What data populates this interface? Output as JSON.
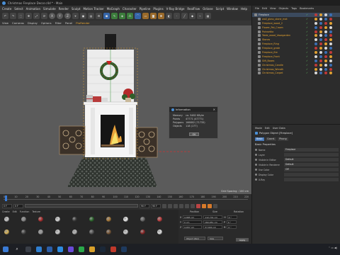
{
  "window": {
    "title": "Christmas Fireplace Decor.c4d * - Main"
  },
  "menubar": [
    "Create",
    "Select",
    "Animation",
    "Simulate",
    "Render",
    "Sculpt",
    "Motion Tracker",
    "MoGraph",
    "Character",
    "Pipeline",
    "Plugins",
    "V-Ray Bridge",
    "RealFlow",
    "Octane",
    "Script",
    "Window",
    "Help"
  ],
  "viewport_menu": {
    "items": [
      "View",
      "Cameras",
      "Display",
      "Options",
      "Filter",
      "Panel"
    ],
    "active": "ProRender"
  },
  "viewport": {
    "grid_spacing": "Grid Spacing : 100 cm"
  },
  "info_dialog": {
    "title": "Information",
    "rows": [
      {
        "label": "Memory",
        "value": "ca. 5482 KByte"
      },
      {
        "label": "Points",
        "value": "47771 (47771)"
      },
      {
        "label": "Polygons",
        "value": "166802 (71735)"
      },
      {
        "label": "Objects",
        "value": "118 (177)"
      }
    ],
    "ok_label": "OK"
  },
  "timeline": {
    "ticks": [
      "0",
      "10",
      "20",
      "30",
      "40",
      "50",
      "60",
      "70",
      "80",
      "90",
      "100",
      "110",
      "120",
      "130",
      "140",
      "150",
      "160",
      "170",
      "180",
      "190",
      "200",
      "210",
      "220"
    ],
    "current_frame": "0 F",
    "start_frame": "0 F",
    "end_frame": "90 F",
    "max_frame": "90 F"
  },
  "materials": {
    "menu": [
      "Create",
      "Edit",
      "Function",
      "Texture"
    ],
    "balls": [
      {
        "color": "#c9c9c9"
      },
      {
        "color": "#8a8a8a"
      },
      {
        "color": "#b03030"
      },
      {
        "color": "#d8d8d8"
      },
      {
        "color": "#3e3e3e"
      },
      {
        "color": "#2e6b2e"
      },
      {
        "color": "#a87a3a"
      },
      {
        "color": "#ececec"
      },
      {
        "color": "#6a6a6a"
      },
      {
        "color": "#c04040"
      },
      {
        "color": "#d7b35a"
      },
      {
        "color": "#4a4a4a"
      },
      {
        "color": "#9a9a9a"
      },
      {
        "color": "#d0d0d0"
      },
      {
        "color": "#b5b5b5"
      },
      {
        "color": "#5a5a5a"
      },
      {
        "color": "#7a5a3a"
      },
      {
        "color": "#cfcfcf"
      },
      {
        "color": "#8e2a2a"
      },
      {
        "color": "#e0e0e0"
      }
    ]
  },
  "coordinates": {
    "headers": [
      "Position",
      "Size",
      "Rotation"
    ],
    "rows": [
      {
        "axis": "X",
        "pos": "0.885 cm",
        "size": "112.741 cm",
        "rot_label": "H",
        "rot": "0 °"
      },
      {
        "axis": "Y",
        "pos": "0 cm",
        "size": "160.281 cm",
        "rot_label": "P",
        "rot": "0 °"
      },
      {
        "axis": "Z",
        "pos": "0.657 cm",
        "size": "57.604 cm",
        "rot_label": "B",
        "rot": "0 °"
      }
    ],
    "mode": "Object (Rel)",
    "size_mode": "Size",
    "apply_label": "Apply"
  },
  "object_manager": {
    "menu": [
      "File",
      "Edit",
      "View",
      "Objects",
      "Tags",
      "Bookmarks"
    ],
    "items": [
      {
        "name": "Fireplace",
        "top": true
      },
      {
        "name": "wall_glass_stone_mat",
        "top": false
      },
      {
        "name": "Fireplace_wood_2",
        "top": false
      },
      {
        "name": "Flower_Pot_Crown",
        "top": false
      },
      {
        "name": "Poinsettia",
        "top": false
      },
      {
        "name": "Table_wood_Vasegarden",
        "top": false
      },
      {
        "name": "Stones",
        "top": false
      },
      {
        "name": "Fireplace_Ring",
        "top": false
      },
      {
        "name": "Fireplace_grate",
        "top": false
      },
      {
        "name": "Fireplace_fire",
        "top": false
      },
      {
        "name": "Fireplace_Front",
        "top": false
      },
      {
        "name": "Gift_Boxes",
        "top": false
      },
      {
        "name": "Christmas_Candle",
        "top": false
      },
      {
        "name": "Christmas_Wreath",
        "top": false
      },
      {
        "name": "Christmas_Carpet",
        "top": false
      }
    ],
    "tag_colors": [
      "#c03a3a",
      "#e0a030",
      "#d8d8d8",
      "#3b6fb5"
    ]
  },
  "attributes": {
    "menu": [
      "Mode",
      "Edit",
      "User Data"
    ],
    "title": "Polygon Object [Fireplace]",
    "tabs": [
      "Basic",
      "Coord.",
      "Phong"
    ],
    "section": "Basic Properties",
    "rows": [
      {
        "label": "Name",
        "value": "Fireplace"
      },
      {
        "label": "Layer",
        "value": ""
      },
      {
        "label": "Visible in Editor",
        "value": "Default"
      },
      {
        "label": "Visible in Renderer",
        "value": "Default"
      },
      {
        "label": "Use Color",
        "value": "Off"
      },
      {
        "label": "Display Color",
        "value": ""
      },
      {
        "label": "X-Ray",
        "value": ""
      }
    ]
  },
  "taskbar": {
    "apps": [
      {
        "name": "task-view",
        "color": "#3a3f48"
      },
      {
        "name": "edge",
        "color": "#2f7fd1"
      },
      {
        "name": "cinema4d",
        "color": "#2b5ea8"
      },
      {
        "name": "vscode",
        "color": "#2d8be0"
      },
      {
        "name": "photos",
        "color": "#6a4ad8"
      },
      {
        "name": "whatsapp",
        "color": "#2aa84a"
      },
      {
        "name": "chrome",
        "color": "#d9a02a"
      },
      {
        "name": "steam",
        "color": "#1b2838"
      },
      {
        "name": "app-red",
        "color": "#c0392b"
      },
      {
        "name": "photoshop",
        "color": "#1e3a5f"
      }
    ]
  }
}
